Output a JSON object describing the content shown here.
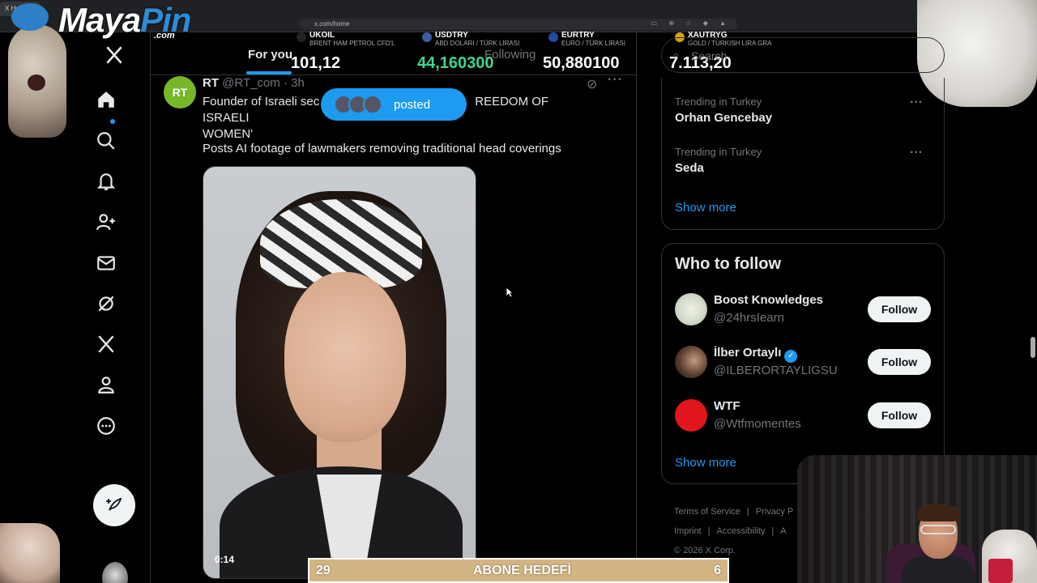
{
  "browser": {
    "tab_title": "Ho",
    "url": "x.com/home"
  },
  "overlay": {
    "logo_main": "Maya",
    "logo_accent": "Pin",
    "logo_sub": ".com",
    "goal_left": "29",
    "goal_label": "ABONE HEDEFİ",
    "goal_right": "6"
  },
  "tickers": [
    {
      "name": "UKOIL",
      "desc": "BRENT HAM PETROL CFD'L",
      "value": "101,12",
      "color": "#ffffff"
    },
    {
      "name": "USDTRY",
      "desc": "ABD DOLARI / TÜRK LİRASI",
      "value": "44,160300",
      "color": "#3fd68c"
    },
    {
      "name": "EURTRY",
      "desc": "EURO / TÜRK LİRASI",
      "value": "50,880100",
      "color": "#ffffff"
    },
    {
      "name": "XAUTRYG",
      "desc": "GOLD / TURKISH LIRA GRA",
      "value": "7.113,20",
      "color": "#ffffff"
    }
  ],
  "sidebar": {
    "items": [
      "x-logo",
      "home",
      "explore",
      "notifications",
      "follow",
      "messages",
      "grok",
      "premium",
      "profile",
      "more"
    ],
    "post_button": "post"
  },
  "main": {
    "tab_for_you": "For you",
    "tab_following": "Following",
    "posted_label": "posted",
    "post": {
      "avatar_text": "RT",
      "name": "RT",
      "handle_time": "@RT_com · 3h",
      "text1": "Founder of Israeli sec                                         REEDOM OF ISRAELI WOMEN'",
      "text1_left": "Founder of Israeli sec",
      "text1_right": "REEDOM OF ISRAELI",
      "text1_line2": "WOMEN'",
      "text2": "Posts AI footage of lawmakers removing traditional head coverings",
      "video_duration": "0:14"
    }
  },
  "right": {
    "search_placeholder": "Search",
    "trends": [
      {
        "context": "Trending in Turkey",
        "title": "Orhan Gencebay"
      },
      {
        "context": "Trending in Turkey",
        "title": "Seda"
      }
    ],
    "show_more": "Show more",
    "who_to_follow": {
      "title": "Who to follow",
      "accounts": [
        {
          "name": "Boost Knowledges",
          "handle": "@24hrsIearn",
          "verified": false,
          "button": "Follow"
        },
        {
          "name": "İlber Ortaylı",
          "handle": "@ILBERORTAYLIGSU",
          "verified": true,
          "button": "Follow"
        },
        {
          "name": "WTF",
          "handle": "@Wtfmomentes",
          "verified": false,
          "button": "Follow"
        }
      ],
      "show_more": "Show more"
    },
    "footer": {
      "terms": "Terms of Service",
      "privacy": "Privacy P",
      "imprint": "Imprint",
      "accessibility": "Accessibility",
      "more": "A",
      "copyright": "© 2026 X Corp."
    }
  }
}
